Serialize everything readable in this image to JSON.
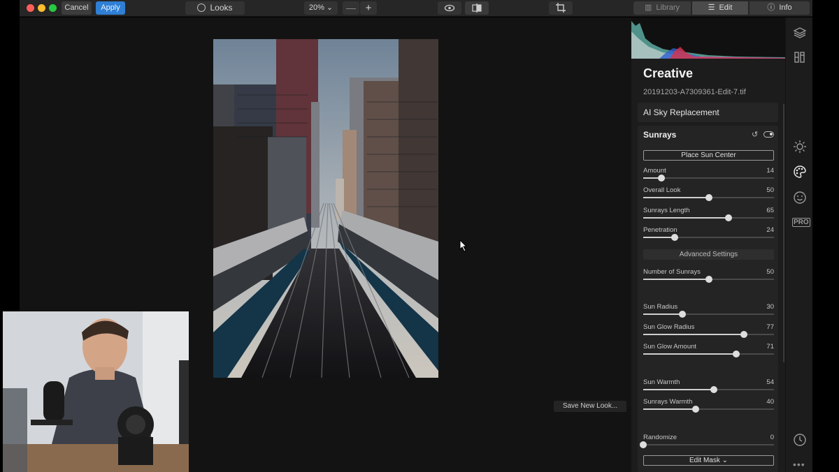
{
  "toolbar": {
    "cancel": "Cancel",
    "apply": "Apply",
    "looks": "Looks",
    "zoom": "20% ⌄",
    "zoom_out": "—",
    "zoom_in": "+"
  },
  "tabs": {
    "library": "Library",
    "edit": "Edit",
    "info": "Info"
  },
  "panel": {
    "title": "Creative",
    "filename": "20191203-A7309361-Edit-7.tif",
    "ai_sky": "AI Sky Replacement",
    "section_title": "Sunrays",
    "place_sun": "Place Sun Center",
    "advanced": "Advanced Settings",
    "edit_mask": "Edit Mask ⌄",
    "sliders": [
      {
        "label": "Amount",
        "value": "14",
        "fraction": 0.14
      },
      {
        "label": "Overall Look",
        "value": "50",
        "fraction": 0.5
      },
      {
        "label": "Sunrays Length",
        "value": "65",
        "fraction": 0.65
      },
      {
        "label": "Penetration",
        "value": "24",
        "fraction": 0.24
      },
      {
        "label": "Number of Sunrays",
        "value": "50",
        "fraction": 0.5
      },
      {
        "label": "Sun Radius",
        "value": "30",
        "fraction": 0.3
      },
      {
        "label": "Sun Glow Radius",
        "value": "77",
        "fraction": 0.77
      },
      {
        "label": "Sun Glow Amount",
        "value": "71",
        "fraction": 0.71
      },
      {
        "label": "Sun Warmth",
        "value": "54",
        "fraction": 0.54
      },
      {
        "label": "Sunrays Warmth",
        "value": "40",
        "fraction": 0.4
      },
      {
        "label": "Randomize",
        "value": "0",
        "fraction": 0.0
      }
    ]
  },
  "canvas": {
    "save_new_look": "Save New Look..."
  },
  "colors": {
    "apply_button": "#2f7fd5",
    "panel_bg": "#1c1c1c",
    "canvas_bg": "#131313"
  },
  "icons": [
    "layers-icon",
    "sliders-icon",
    "sun-icon",
    "palette-icon",
    "face-icon",
    "clock-icon",
    "more-icon",
    "eye-icon",
    "compare-icon",
    "crop-icon",
    "looks-icon"
  ]
}
